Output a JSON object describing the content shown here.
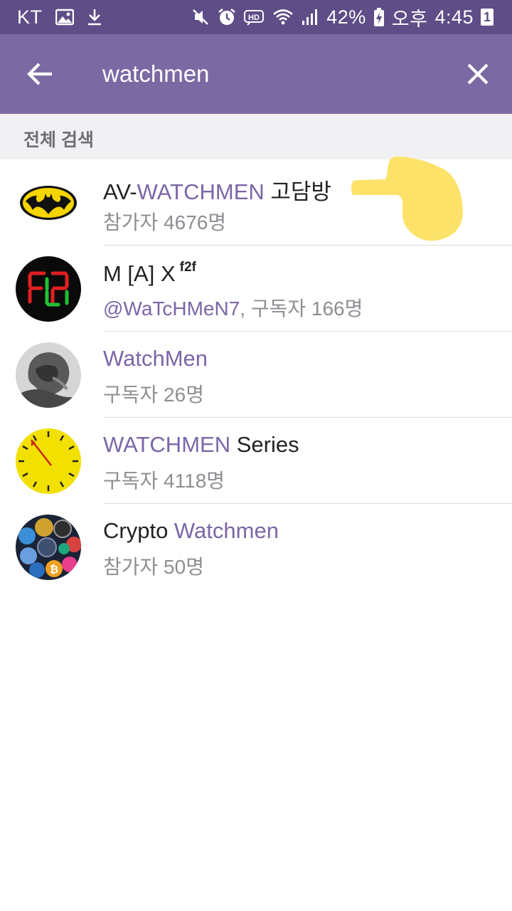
{
  "status_bar": {
    "carrier": "KT",
    "battery_percent": "42%",
    "ampm": "오후",
    "time": "4:45",
    "notification_count": "1",
    "icons": [
      "gallery-icon",
      "download-icon",
      "mute-icon",
      "alarm-icon",
      "hd-icon",
      "wifi-icon",
      "signal-icon",
      "battery-charging-icon"
    ]
  },
  "search": {
    "query": "watchmen",
    "back_icon": "back-arrow-icon",
    "clear_icon": "close-icon"
  },
  "section": {
    "title": "전체 검색"
  },
  "results": [
    {
      "title_pre": "AV-",
      "title_hl": "WATCHMEN",
      "title_post": " 고담방",
      "subtitle": "참가자 4676명",
      "avatar": "batman-logo-avatar"
    },
    {
      "title_pre": "M [A] X",
      "title_sup": "f2f",
      "subtitle_hl": "@WaTcHMeN7",
      "subtitle_rest": ", 구독자 166명",
      "avatar": "f2f-digital-avatar"
    },
    {
      "title_hl": "WatchMen",
      "subtitle": "구독자 26명",
      "avatar": "statue-avatar"
    },
    {
      "title_hl": "WATCHMEN",
      "title_post": " Series",
      "subtitle": "구독자 4118명",
      "avatar": "yellow-clock-avatar"
    },
    {
      "title_pre": "Crypto ",
      "title_hl": "Watchmen",
      "subtitle": "참가자 50명",
      "avatar": "crypto-coins-avatar"
    }
  ],
  "annotation": {
    "icon": "pointing-hand-icon",
    "color": "#fde26a"
  },
  "colors": {
    "status_bar": "#5e4d86",
    "app_bar": "#7b69a3",
    "highlight": "#7b66a6",
    "section_bg": "#f1f1f4"
  }
}
